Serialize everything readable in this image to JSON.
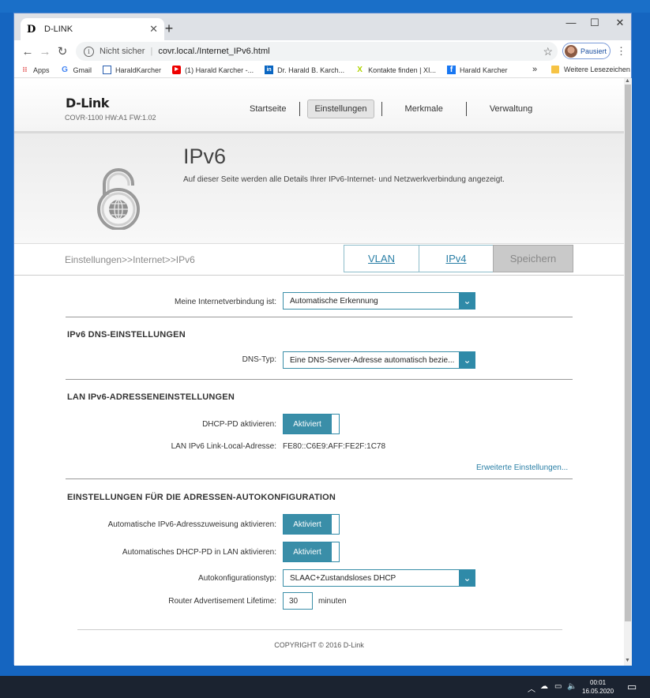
{
  "browser": {
    "tab_title": "D-LINK",
    "tab_favicon": "D",
    "new_tab": "+",
    "security_label": "Nicht sicher",
    "url": "covr.local./Internet_IPv6.html",
    "profile_label": "Pausiert",
    "bookmarks": [
      {
        "label": "Apps",
        "icon": "apps-icon"
      },
      {
        "label": "Gmail",
        "icon": "google-icon"
      },
      {
        "label": "HaraldKarcher",
        "icon": "page-icon"
      },
      {
        "label": "(1) Harald Karcher -...",
        "icon": "youtube-icon"
      },
      {
        "label": "Dr. Harald B. Karch...",
        "icon": "linkedin-icon"
      },
      {
        "label": "Kontakte finden | XI...",
        "icon": "xing-icon"
      },
      {
        "label": "Harald Karcher",
        "icon": "facebook-icon"
      }
    ],
    "bookmarks_more": "»",
    "other_bookmarks": "Weitere Lesezeichen"
  },
  "header": {
    "logo": "D-Link",
    "model": "COVR-1100 HW:A1 FW:1.02",
    "nav": [
      "Startseite",
      "Einstellungen",
      "Merkmale",
      "Verwaltung"
    ],
    "active_nav": "Einstellungen"
  },
  "hero": {
    "title": "IPv6",
    "description": "Auf dieser Seite werden alle Details Ihrer IPv6-Internet- und Netzwerkverbindung angezeigt."
  },
  "subnav": {
    "breadcrumb": "Einstellungen>>Internet>>IPv6",
    "vlan": "VLAN",
    "ipv4": "IPv4",
    "save": "Speichern"
  },
  "form": {
    "connection_label": "Meine Internetverbindung ist:",
    "connection_value": "Automatische Erkennung",
    "dns_section": "IPv6 DNS-EINSTELLUNGEN",
    "dns_type_label": "DNS-Typ:",
    "dns_type_value": "Eine DNS-Server-Adresse automatisch bezie...",
    "lan_section": "LAN IPv6-ADRESSENEINSTELLUNGEN",
    "dhcp_pd_label": "DHCP-PD aktivieren:",
    "dhcp_pd_value": "Aktiviert",
    "link_local_label": "LAN IPv6 Link-Local-Adresse:",
    "link_local_value": "FE80::C6E9:AFF:FE2F:1C78",
    "advanced_link": "Erweiterte Einstellungen...",
    "autoconf_section": "EINSTELLUNGEN FÜR DIE ADRESSEN-AUTOKONFIGURATION",
    "auto_assign_label": "Automatische IPv6-Adresszuweisung aktivieren:",
    "auto_assign_value": "Aktiviert",
    "auto_dhcp_pd_label": "Automatisches DHCP-PD in LAN aktivieren:",
    "auto_dhcp_pd_value": "Aktiviert",
    "autoconf_type_label": "Autokonfigurationstyp:",
    "autoconf_type_value": "SLAAC+Zustandsloses DHCP",
    "ra_lifetime_label": "Router Advertisement Lifetime:",
    "ra_lifetime_value": "30",
    "ra_lifetime_unit": "minuten"
  },
  "footer": {
    "copyright": "COPYRIGHT © 2016 D-Link"
  },
  "taskbar": {
    "time": "00:01",
    "date": "16.05.2020"
  }
}
